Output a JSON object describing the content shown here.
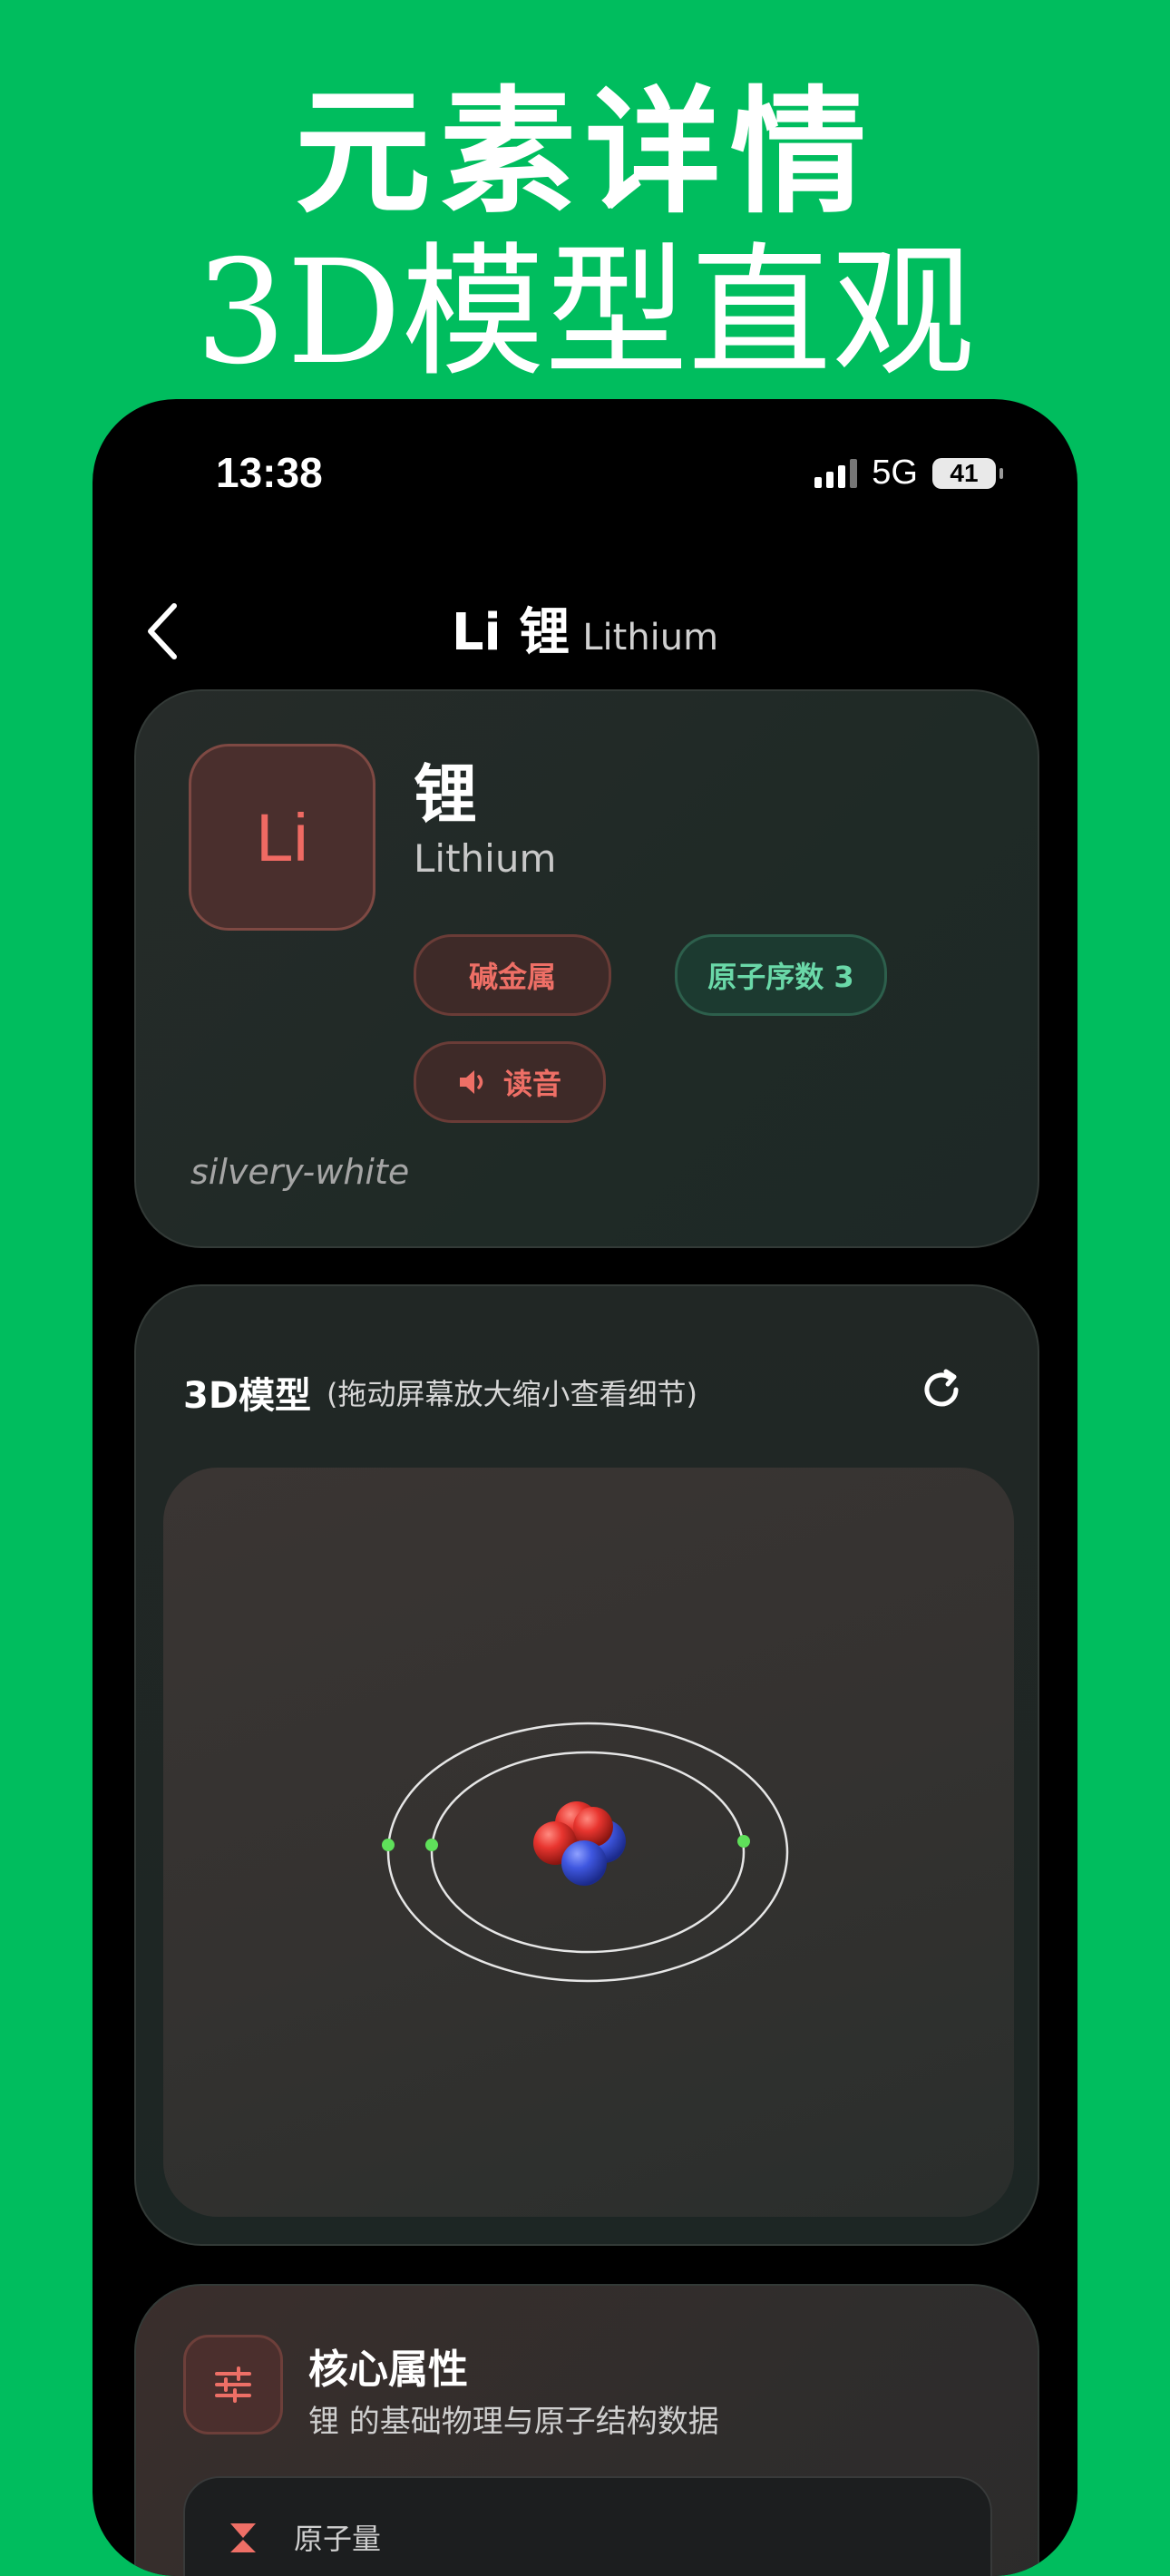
{
  "promo": {
    "line1": "元素详情",
    "line2": "3D模型直观"
  },
  "status_bar": {
    "time": "13:38",
    "network": "5G",
    "battery": "41"
  },
  "nav": {
    "symbol_name": "Li 锂",
    "english": "Lithium"
  },
  "element": {
    "symbol": "Li",
    "name": "锂",
    "english": "Lithium",
    "category": "碱金属",
    "atomic_number_label": "原子序数 3",
    "pronounce_label": "读音",
    "appearance": "silvery-white"
  },
  "model": {
    "title": "3D模型",
    "hint": "(拖动屏幕放大缩小查看细节)"
  },
  "properties": {
    "title": "核心属性",
    "subtitle": "锂 的基础物理与原子结构数据",
    "first_row_label": "原子量"
  },
  "colors": {
    "background": "#00bd5e",
    "accent_red": "#ee6f66",
    "accent_green": "#6ad8a8",
    "electron": "#5fe05a",
    "proton": "#e83a35",
    "neutron": "#3f57e0"
  }
}
